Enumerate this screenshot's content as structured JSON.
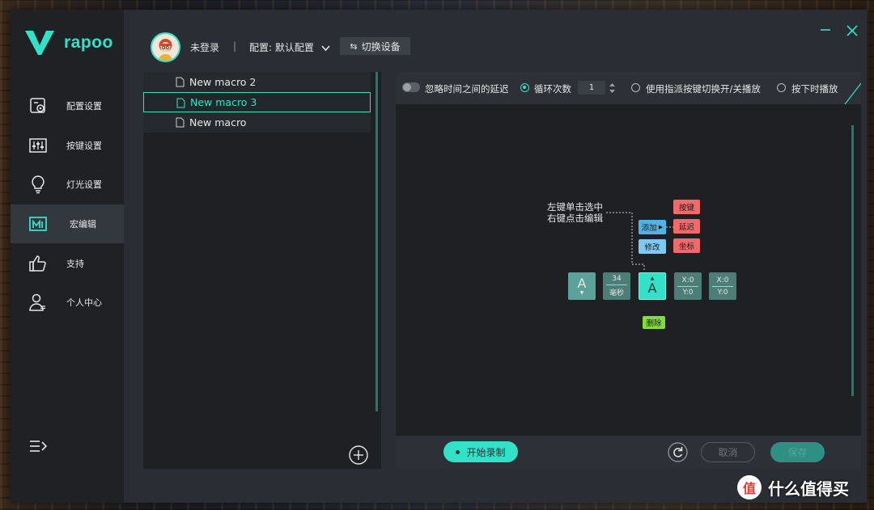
{
  "app": {
    "brand": "rapoo",
    "accent_color": "#33e0c8",
    "sidebar_bg": "#1f2125",
    "panel_bg": "#1e2024"
  },
  "header": {
    "user_status": "未登录",
    "separator": "|",
    "config_label": "配置: 默认配置",
    "switch_device": "切换设备",
    "window_controls": [
      "minimize-icon",
      "close-icon"
    ]
  },
  "sidebar": {
    "items": [
      {
        "label": "配置设置",
        "icon": "config-icon"
      },
      {
        "label": "按键设置",
        "icon": "sliders-icon"
      },
      {
        "label": "灯光设置",
        "icon": "lightbulb-icon"
      },
      {
        "label": "宏编辑",
        "icon": "macro-icon",
        "active": true
      },
      {
        "label": "支持",
        "icon": "thumbs-up-icon"
      },
      {
        "label": "个人中心",
        "icon": "user-icon"
      }
    ]
  },
  "macro_list": {
    "items": [
      {
        "name": "New macro 2",
        "selected": false
      },
      {
        "name": "New macro 3",
        "selected": true
      },
      {
        "name": "New macro",
        "selected": false
      }
    ]
  },
  "toolbar": {
    "ignore_delay_label": "忽略时间之间的延迟",
    "ignore_delay_on": false,
    "loop_label": "循环次数",
    "loop_count": "1",
    "toggle_play_label": "使用指派按键切换开/关播放",
    "hold_play_label": "按下时播放",
    "selected_mode": "loop"
  },
  "hint": {
    "line1": "左键单击选中",
    "line2": "右键点击编辑",
    "add_label": "添加",
    "modify_label": "修改",
    "key_label": "按键",
    "delay_label": "延迟",
    "coord_label": "坐标",
    "delete_label": "删除",
    "steps": {
      "key1": "A",
      "delay_value": "34",
      "delay_unit": "毫秒",
      "key2": "A",
      "xy1_x": "X:0",
      "xy1_y": "Y:0",
      "xy2_x": "X:0",
      "xy2_y": "Y:0"
    }
  },
  "bottom": {
    "record_label": "开始录制",
    "cancel_label": "取消",
    "save_label": "保存"
  },
  "watermark": {
    "circle_text": "值",
    "text": "什么值得买"
  }
}
